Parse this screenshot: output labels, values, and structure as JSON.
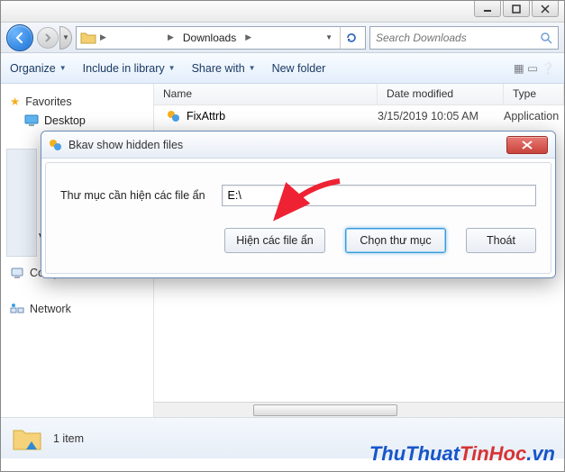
{
  "window": {
    "breadcrumb_current": "Downloads",
    "search_placeholder": "Search Downloads"
  },
  "toolbar": {
    "organize": "Organize",
    "include": "Include in library",
    "share": "Share with",
    "newfolder": "New folder"
  },
  "columns": {
    "name": "Name",
    "date": "Date modified",
    "type": "Type"
  },
  "files": [
    {
      "name": "FixAttrb",
      "date": "3/15/2019 10:05 AM",
      "type": "Application"
    }
  ],
  "sidebar": {
    "favorites": "Favorites",
    "desktop": "Desktop",
    "videos": "Videos",
    "computer": "Computer",
    "network": "Network"
  },
  "status": {
    "count": "1 item"
  },
  "dialog": {
    "title": "Bkav show hidden files",
    "field_label": "Thư mục cần hiện các file ẩn",
    "field_value": "E:\\",
    "btn_show": "Hiện các file ẩn",
    "btn_browse": "Chọn thư mục",
    "btn_exit": "Thoát"
  },
  "watermark": {
    "part1": "ThuThuat",
    "part2": "TinHoc",
    "part3": ".vn"
  }
}
